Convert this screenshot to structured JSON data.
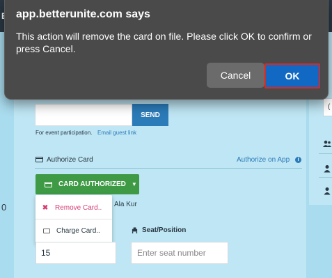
{
  "dialog": {
    "title": "app.betterunite.com says",
    "message": "This action will remove the card on file. Please click OK to confirm or press Cancel.",
    "cancel_label": "Cancel",
    "ok_label": "OK",
    "ok_color": "#1269c4",
    "highlight_color": "#d72a25"
  },
  "page": {
    "left_edge_letter": "E",
    "left_edge_digit": "0",
    "send_label": "SEND",
    "event_note": "For event participation.",
    "guest_link": "Email guest link",
    "authorize_title": "Authorize Card",
    "authorize_app_link": "Authorize on App",
    "card_button_label": "CARD AUTHORIZED",
    "name_fragment": "Ala Kur",
    "seat_label": "Seat/Position",
    "quantity_value": "15",
    "seat_placeholder": "Enter seat number",
    "right_panel_value": "("
  },
  "dropdown": {
    "remove_label": "Remove Card..",
    "charge_label": "Charge Card.."
  },
  "colors": {
    "page_bg": "#a9dcee",
    "panel_bg": "#bfe6f4",
    "primary_blue": "#2b7bb9",
    "success_green": "#3e9a45",
    "danger_pink": "#d63c72"
  },
  "icons": [
    "credit-card-icon",
    "info-icon",
    "caret-down-icon",
    "close-x-icon",
    "money-icon",
    "seat-icon",
    "users-icon",
    "user-icon"
  ]
}
